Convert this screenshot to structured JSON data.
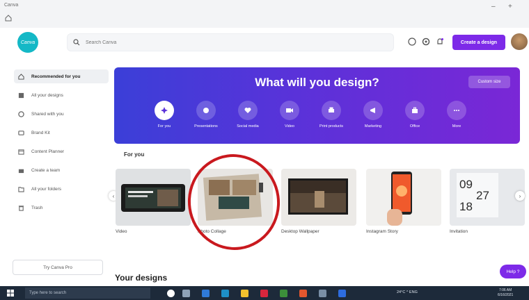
{
  "window": {
    "app_label": "Canva",
    "minimize": "–",
    "maximize": "+"
  },
  "topbar": {
    "logo_text": "Canva",
    "search_placeholder": "Search Canva",
    "create_button": "Create a design"
  },
  "sidebar": {
    "items": [
      {
        "label": "Recommended for you",
        "icon": "home-icon"
      },
      {
        "label": "All your designs",
        "icon": "grid-icon"
      },
      {
        "label": "Shared with you",
        "icon": "people-icon"
      },
      {
        "label": "Brand Kit",
        "icon": "brand-icon"
      },
      {
        "label": "Content Planner",
        "icon": "calendar-icon"
      },
      {
        "label": "Create a team",
        "icon": "team-icon"
      },
      {
        "label": "All your folders",
        "icon": "folder-icon"
      },
      {
        "label": "Trash",
        "icon": "trash-icon"
      }
    ],
    "try_pro": "Try Canva Pro"
  },
  "hero": {
    "title": "What will you design?",
    "custom_size": "Custom size",
    "categories": [
      {
        "label": "For you",
        "icon": "sparkle-icon"
      },
      {
        "label": "Presentations",
        "icon": "presentation-icon"
      },
      {
        "label": "Social media",
        "icon": "heart-icon"
      },
      {
        "label": "Video",
        "icon": "video-icon"
      },
      {
        "label": "Print products",
        "icon": "print-icon"
      },
      {
        "label": "Marketing",
        "icon": "megaphone-icon"
      },
      {
        "label": "Office",
        "icon": "briefcase-icon"
      },
      {
        "label": "More",
        "icon": "more-icon"
      }
    ]
  },
  "for_you": {
    "heading": "For you",
    "cards": [
      {
        "label": "Video"
      },
      {
        "label": "Photo Collage"
      },
      {
        "label": "Desktop Wallpaper"
      },
      {
        "label": "Instagram Story"
      },
      {
        "label": "Invitation"
      }
    ],
    "invitation_text_1": "09",
    "invitation_text_2": "27",
    "invitation_text_3": "18"
  },
  "your_designs": "Your designs",
  "help_button": "Help ?",
  "taskbar": {
    "search_placeholder": "Type here to search",
    "tray": "24°C  ^  ENG",
    "time": "7:06 AM",
    "date": "6/16/2021"
  },
  "colors": {
    "brand_purple": "#7d2ae8",
    "hero_start": "#3b3fd8",
    "hero_end": "#7a27d6",
    "annotation_red": "#c9191e",
    "logo_teal": "#14b8c6"
  }
}
